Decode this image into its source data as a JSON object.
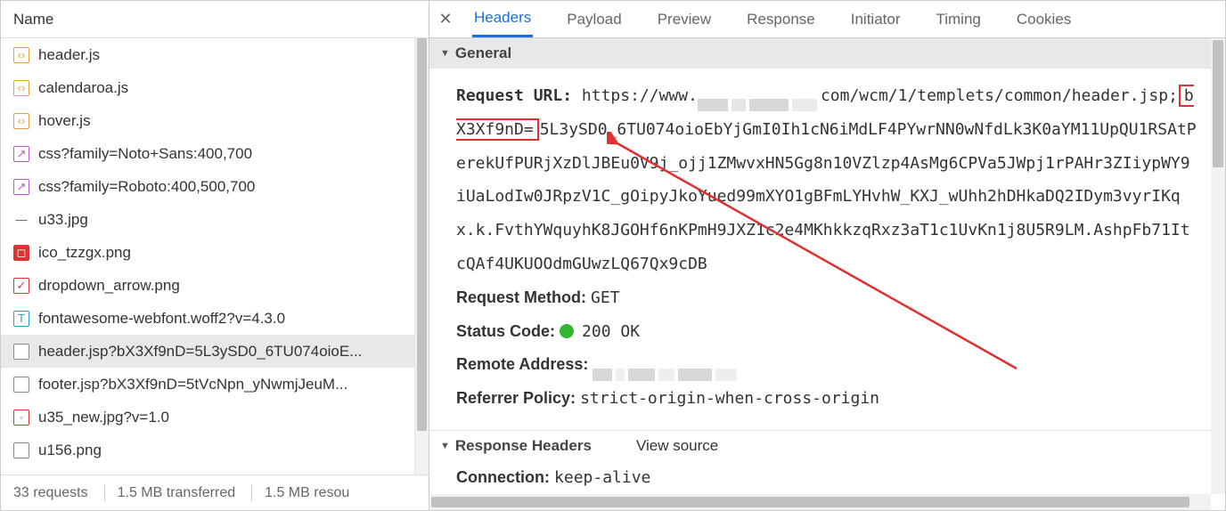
{
  "left": {
    "header": "Name",
    "files": [
      {
        "icon": "js",
        "name": "header.js"
      },
      {
        "icon": "js",
        "name": "calendaroa.js"
      },
      {
        "icon": "js",
        "name": "hover.js"
      },
      {
        "icon": "css",
        "name": "css?family=Noto+Sans:400,700"
      },
      {
        "icon": "css",
        "name": "css?family=Roboto:400,500,700"
      },
      {
        "icon": "dash",
        "name": "u33.jpg"
      },
      {
        "icon": "red",
        "name": "ico_tzzgx.png"
      },
      {
        "icon": "check",
        "name": "dropdown_arrow.png"
      },
      {
        "icon": "font",
        "name": "fontawesome-webfont.woff2?v=4.3.0"
      },
      {
        "icon": "doc",
        "name": "header.jsp?bX3Xf9nD=5L3ySD0_6TU074oioE..."
      },
      {
        "icon": "doc",
        "name": "footer.jsp?bX3Xf9nD=5tVcNpn_yNwmjJeuM..."
      },
      {
        "icon": "thumb",
        "name": "u35_new.jpg?v=1.0"
      },
      {
        "icon": "blank",
        "name": "u156.png"
      }
    ],
    "footer": {
      "requests": "33 requests",
      "transferred": "1.5 MB transferred",
      "resources": "1.5 MB resou"
    },
    "selected_index": 9
  },
  "tabs": [
    "Headers",
    "Payload",
    "Preview",
    "Response",
    "Initiator",
    "Timing",
    "Cookies"
  ],
  "active_tab": 0,
  "general": {
    "title": "General",
    "request_url_label": "Request URL:",
    "url_prefix": "https://www.",
    "url_mid": "com/wcm/1/templets/common/header.jsp",
    "url_param_key": "bX3Xf9nD=",
    "url_param_sep_char": ";",
    "url_param_value": "5L3ySD0_6TU074oioEbYjGmI0Ih1cN6iMdLF4PYwrNN0wNfdLk3K0aYM11UpQU1RSAtPerekUfPURjXzDlJBEu0V9j_ojj1ZMwvxHN5Gg8n10VZlzp4AsMg6CPVa5JWpj1rPAHr3ZIiypWY9iUaLodIw0JRpzV1C_gOipyJkoYued99mXYO1gBFmLYHvhW_KXJ_wUhh2hDHkaDQ2IDym3vyrIKqx.k.FvthYWquyhK8JGOHf6nKPmH9JXZ1c2e4MKhkkzqRxz3aT1c1UvKn1j8U5R9LM.AshpFb71ItcQAf4UKUOOdmGUwzLQ67Qx9cDB",
    "request_method_label": "Request Method:",
    "request_method": "GET",
    "status_code_label": "Status Code:",
    "status_code": "200 OK",
    "remote_address_label": "Remote Address:",
    "referrer_policy_label": "Referrer Policy:",
    "referrer_policy": "strict-origin-when-cross-origin"
  },
  "response_headers": {
    "title": "Response Headers",
    "view_source": "View source",
    "connection_label": "Connection:",
    "connection": "keep-alive"
  }
}
